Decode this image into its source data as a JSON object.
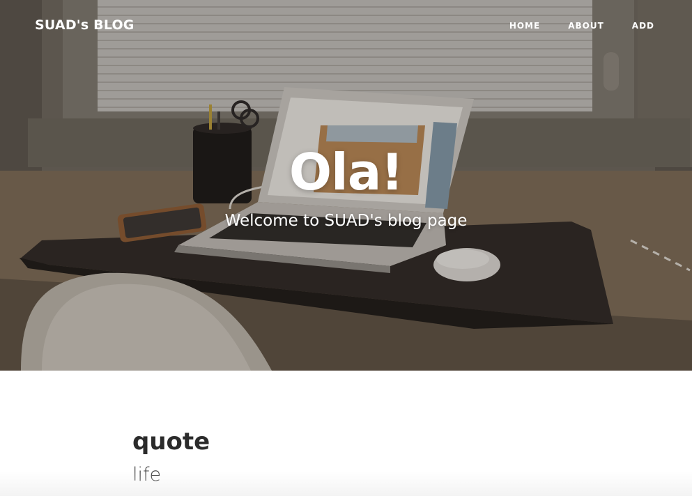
{
  "navbar": {
    "brand": "SUAD's BLOG",
    "links": [
      {
        "label": "HOME"
      },
      {
        "label": "ABOUT"
      },
      {
        "label": "ADD"
      }
    ]
  },
  "hero": {
    "heading": "Ola!",
    "subheading": "Welcome to SUAD's blog page"
  },
  "posts": [
    {
      "title": "quote",
      "subtitle": "life"
    }
  ]
}
